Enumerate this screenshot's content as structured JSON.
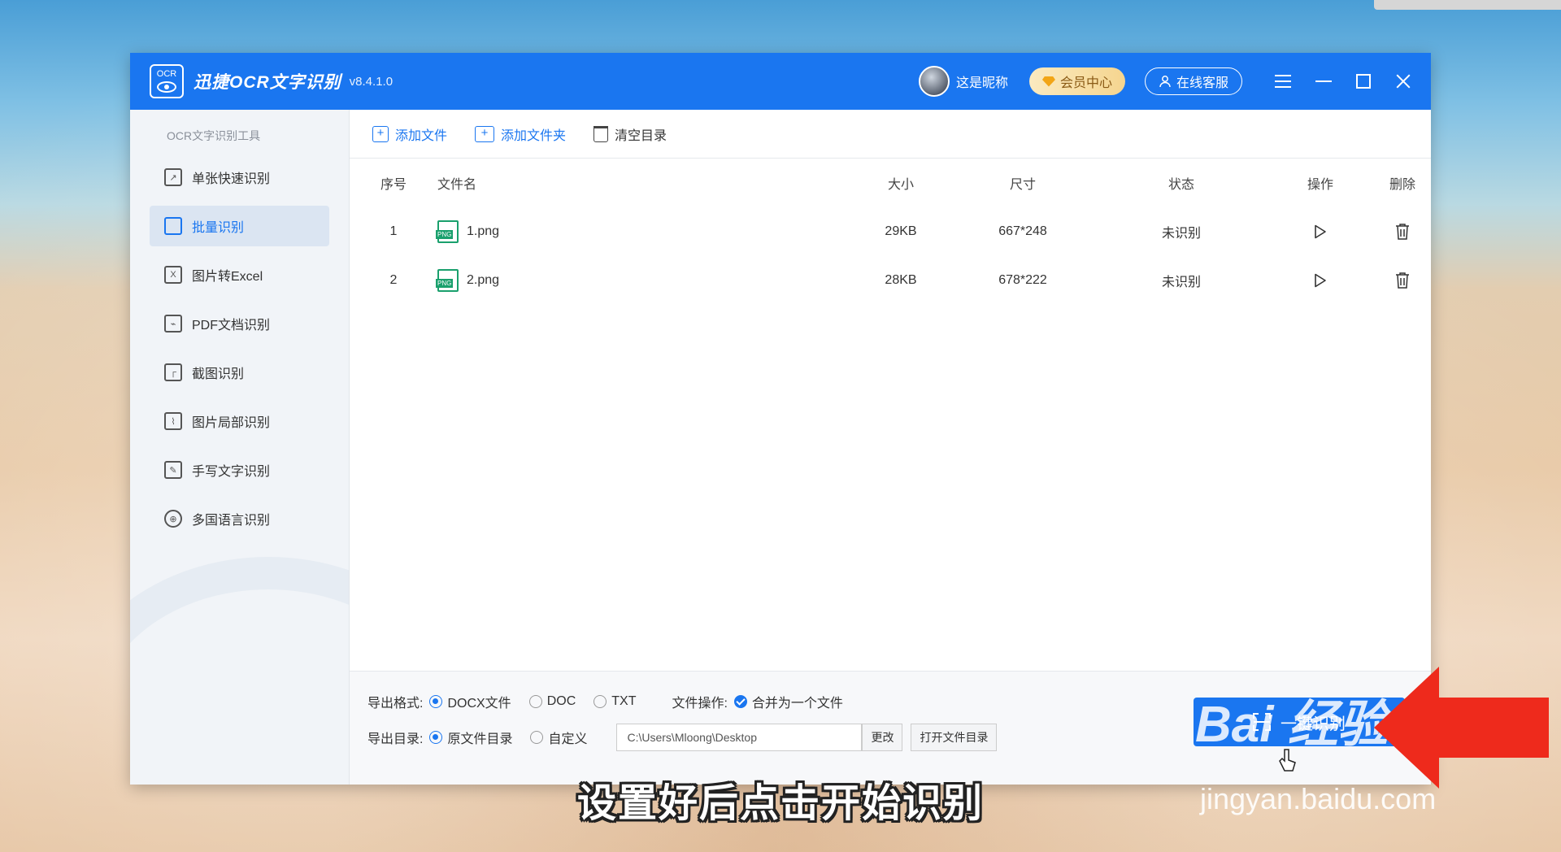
{
  "app": {
    "logo_text": "OCR",
    "name": "迅捷OCR文字识别",
    "version": "v8.4.1.0",
    "nickname": "这是昵称",
    "vip_label": "会员中心",
    "service_label": "在线客服",
    "accent_color": "#1a76f0"
  },
  "sidebar": {
    "heading": "OCR文字识别工具",
    "items": [
      {
        "label": "单张快速识别",
        "icon": "image-scan-icon",
        "glyph": "↗",
        "active": false
      },
      {
        "label": "批量识别",
        "icon": "batch-icon",
        "glyph": "",
        "active": true
      },
      {
        "label": "图片转Excel",
        "icon": "excel-icon",
        "glyph": "X",
        "active": false
      },
      {
        "label": "PDF文档识别",
        "icon": "pdf-icon",
        "glyph": "⌁",
        "active": false
      },
      {
        "label": "截图识别",
        "icon": "crop-icon",
        "glyph": "┌",
        "active": false
      },
      {
        "label": "图片局部识别",
        "icon": "partial-scan-icon",
        "glyph": "⌇",
        "active": false
      },
      {
        "label": "手写文字识别",
        "icon": "pen-icon",
        "glyph": "✎",
        "active": false
      },
      {
        "label": "多国语言识别",
        "icon": "globe-icon",
        "glyph": "⊕",
        "active": false
      }
    ]
  },
  "toolbar": {
    "add_file": "添加文件",
    "add_folder": "添加文件夹",
    "clear": "清空目录"
  },
  "table": {
    "headers": {
      "index": "序号",
      "name": "文件名",
      "size": "大小",
      "dimensions": "尺寸",
      "status": "状态",
      "action": "操作",
      "delete": "删除"
    },
    "rows": [
      {
        "index": "1",
        "name": "1.png",
        "size": "29KB",
        "dimensions": "667*248",
        "status": "未识别"
      },
      {
        "index": "2",
        "name": "2.png",
        "size": "28KB",
        "dimensions": "678*222",
        "status": "未识别"
      }
    ],
    "file_badge": "PNG"
  },
  "footer": {
    "format_label": "导出格式:",
    "formats": [
      "DOCX文件",
      "DOC",
      "TXT"
    ],
    "file_op_label": "文件操作:",
    "merge_label": "合并为一个文件",
    "dir_label": "导出目录:",
    "dir_options": [
      "原文件目录",
      "自定义"
    ],
    "path": "C:\\Users\\Mloong\\Desktop",
    "change_btn": "更改",
    "open_dir_btn": "打开文件目录",
    "start_btn": "一键识别"
  },
  "overlay": {
    "subtitle": "设置好后点击开始识别",
    "watermark": "Bai 经验",
    "watermark_url": "jingyan.baidu.com"
  }
}
